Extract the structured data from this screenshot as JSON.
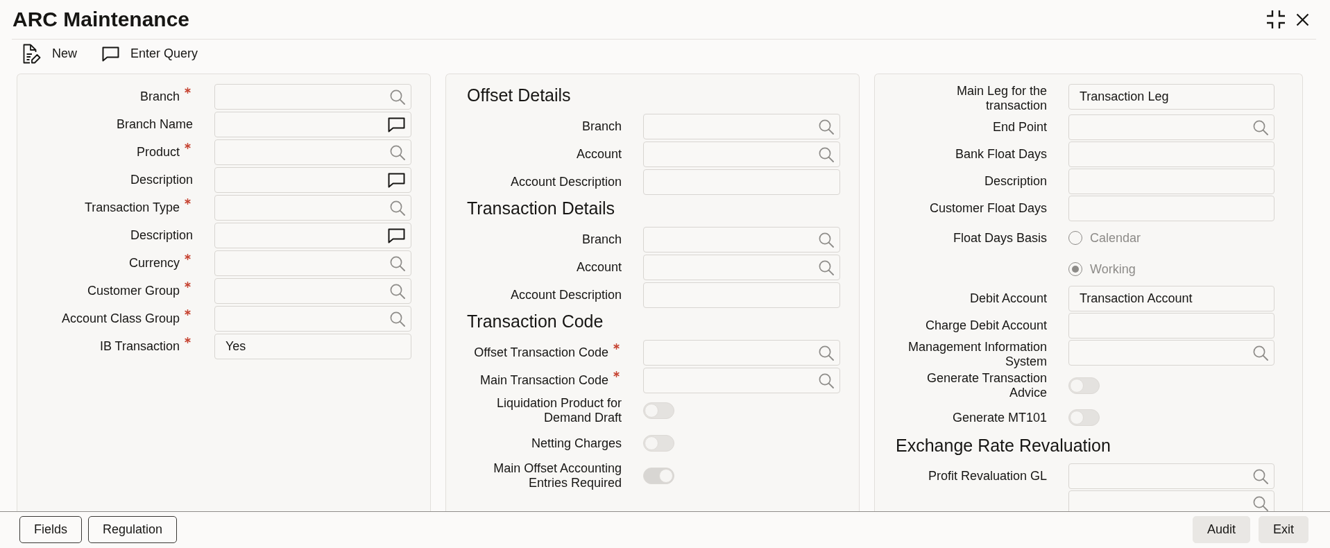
{
  "window": {
    "title": "ARC Maintenance"
  },
  "toolbar": [
    {
      "kind": "new",
      "label": "New"
    },
    {
      "kind": "query",
      "label": "Enter Query"
    }
  ],
  "panels": [
    {
      "rows": [
        {
          "kind": "lookup",
          "label": "Branch",
          "required": true
        },
        {
          "kind": "narrative",
          "label": "Branch Name",
          "required": false
        },
        {
          "kind": "lookup",
          "label": "Product",
          "required": true
        },
        {
          "kind": "narrative",
          "label": "Description",
          "required": false
        },
        {
          "kind": "lookup",
          "label": "Transaction Type",
          "required": true
        },
        {
          "kind": "narrative",
          "label": "Description",
          "required": false
        },
        {
          "kind": "lookup",
          "label": "Currency",
          "required": true
        },
        {
          "kind": "lookup",
          "label": "Customer Group",
          "required": true
        },
        {
          "kind": "lookup",
          "label": "Account Class Group",
          "required": true
        },
        {
          "kind": "text",
          "label": "IB Transaction",
          "required": true,
          "value": "Yes"
        }
      ]
    },
    {
      "rows": [
        {
          "kind": "heading",
          "text": "Offset Details"
        },
        {
          "kind": "lookup",
          "label": "Branch",
          "required": false
        },
        {
          "kind": "lookup",
          "label": "Account",
          "required": false
        },
        {
          "kind": "text",
          "label": "Account Description",
          "required": false
        },
        {
          "kind": "heading",
          "text": "Transaction Details"
        },
        {
          "kind": "lookup",
          "label": "Branch",
          "required": false
        },
        {
          "kind": "lookup",
          "label": "Account",
          "required": false
        },
        {
          "kind": "text",
          "label": "Account Description",
          "required": false
        },
        {
          "kind": "heading",
          "text": "Transaction Code"
        },
        {
          "kind": "lookup",
          "label": "Offset Transaction Code",
          "required": true
        },
        {
          "kind": "lookup",
          "label": "Main Transaction Code",
          "required": true
        },
        {
          "kind": "toggle",
          "label": "Liquidation Product for Demand Draft",
          "required": false,
          "on": false,
          "disabled": true
        },
        {
          "kind": "toggle",
          "label": "Netting Charges",
          "required": false,
          "on": false,
          "disabled": true
        },
        {
          "kind": "toggle",
          "label": "Main Offset Accounting Entries Required",
          "required": false,
          "on": true,
          "disabled": true
        }
      ]
    },
    {
      "rows": [
        {
          "kind": "text",
          "label": "Main Leg for the transaction",
          "required": false,
          "value": "Transaction Leg"
        },
        {
          "kind": "lookup",
          "label": "End Point",
          "required": false
        },
        {
          "kind": "text",
          "label": "Bank Float Days",
          "required": false
        },
        {
          "kind": "text",
          "label": "Description",
          "required": false
        },
        {
          "kind": "text",
          "label": "Customer Float Days",
          "required": false
        },
        {
          "kind": "radio",
          "label": "Float Days Basis",
          "required": false,
          "disabled": true,
          "options": [
            {
              "label": "Calendar",
              "selected": false
            },
            {
              "label": "Working",
              "selected": true
            }
          ]
        },
        {
          "kind": "text",
          "label": "Debit Account",
          "required": false,
          "value": "Transaction Account"
        },
        {
          "kind": "text",
          "label": "Charge Debit Account",
          "required": false
        },
        {
          "kind": "lookup",
          "label": "Management Information System",
          "required": false
        },
        {
          "kind": "toggle",
          "label": "Generate Transaction Advice",
          "required": false,
          "on": false,
          "disabled": true
        },
        {
          "kind": "toggle",
          "label": "Generate MT101",
          "required": false,
          "on": false,
          "disabled": true
        },
        {
          "kind": "heading",
          "text": "Exchange Rate Revaluation"
        },
        {
          "kind": "lookup",
          "label": "Profit Revaluation GL",
          "required": false
        },
        {
          "kind": "lookup"
        }
      ]
    }
  ],
  "footer": {
    "left": [
      "Fields",
      "Regulation"
    ],
    "right": [
      "Audit",
      "Exit"
    ]
  }
}
